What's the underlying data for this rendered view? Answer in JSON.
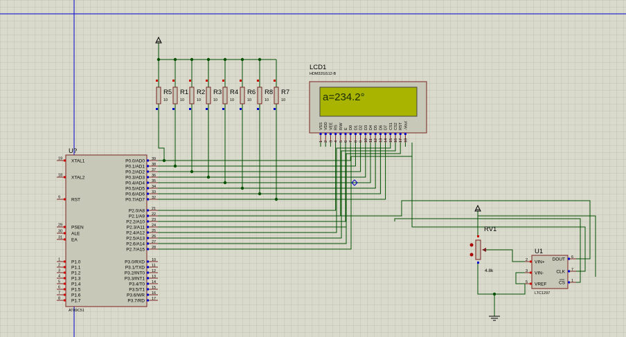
{
  "mcu": {
    "ref": "U?",
    "part": "AT89C51",
    "left_pins": [
      {
        "num": "19",
        "name": "XTAL1"
      },
      {
        "num": "18",
        "name": "XTAL2"
      },
      {
        "num": "9",
        "name": "RST"
      },
      {
        "num": "29",
        "name": "PSEN"
      },
      {
        "num": "30",
        "name": "ALE"
      },
      {
        "num": "31",
        "name": "EA"
      },
      {
        "num": "1",
        "name": "P1.0"
      },
      {
        "num": "2",
        "name": "P1.1"
      },
      {
        "num": "3",
        "name": "P1.2"
      },
      {
        "num": "4",
        "name": "P1.3"
      },
      {
        "num": "5",
        "name": "P1.4"
      },
      {
        "num": "6",
        "name": "P1.5"
      },
      {
        "num": "7",
        "name": "P1.6"
      },
      {
        "num": "8",
        "name": "P1.7"
      }
    ],
    "right_pins": [
      {
        "num": "39",
        "name": "P0.0/AD0"
      },
      {
        "num": "38",
        "name": "P0.1/AD1"
      },
      {
        "num": "37",
        "name": "P0.2/AD2"
      },
      {
        "num": "36",
        "name": "P0.3/AD3"
      },
      {
        "num": "35",
        "name": "P0.4/AD4"
      },
      {
        "num": "34",
        "name": "P0.5/AD5"
      },
      {
        "num": "33",
        "name": "P0.6/AD6"
      },
      {
        "num": "32",
        "name": "P0.7/AD7"
      },
      {
        "num": "21",
        "name": "P2.0/A8"
      },
      {
        "num": "22",
        "name": "P2.1/A9"
      },
      {
        "num": "23",
        "name": "P2.2/A10"
      },
      {
        "num": "24",
        "name": "P2.3/A11"
      },
      {
        "num": "25",
        "name": "P2.4/A12"
      },
      {
        "num": "26",
        "name": "P2.5/A13"
      },
      {
        "num": "27",
        "name": "P2.6/A14"
      },
      {
        "num": "28",
        "name": "P2.7/A15"
      },
      {
        "num": "10",
        "name": "P3.0/RXD"
      },
      {
        "num": "11",
        "name": "P3.1/TXD"
      },
      {
        "num": "12",
        "name": "P3.2/INT0"
      },
      {
        "num": "13",
        "name": "P3.3/INT1"
      },
      {
        "num": "14",
        "name": "P3.4/T0"
      },
      {
        "num": "15",
        "name": "P3.5/T1"
      },
      {
        "num": "16",
        "name": "P3.6/WR"
      },
      {
        "num": "17",
        "name": "P3.7/RD"
      }
    ]
  },
  "resistors": [
    {
      "ref": "R5",
      "value": "10"
    },
    {
      "ref": "R1",
      "value": "10"
    },
    {
      "ref": "R2",
      "value": "10"
    },
    {
      "ref": "R3",
      "value": "10"
    },
    {
      "ref": "R4",
      "value": "10"
    },
    {
      "ref": "R6",
      "value": "10"
    },
    {
      "ref": "R8",
      "value": "10"
    },
    {
      "ref": "R7",
      "value": "10"
    }
  ],
  "lcd": {
    "ref": "LCD1",
    "part": "HDM32GS12-B",
    "display_text": "a=234.2°",
    "pin_names": [
      "VSS",
      "VDD",
      "VEE",
      "RS",
      "R/W",
      "E",
      "D0",
      "D1",
      "D2",
      "D3",
      "D4",
      "D5",
      "D6",
      "D7",
      "CS1",
      "CS2",
      "RST",
      "-Vout"
    ],
    "pin_numbers": [
      "1",
      "2",
      "3",
      "4",
      "5",
      "6",
      "7",
      "8",
      "9",
      "10",
      "11",
      "12",
      "13",
      "14",
      "15",
      "16",
      "17",
      "18"
    ]
  },
  "pot": {
    "ref": "RV1",
    "value": "4.8k"
  },
  "adc": {
    "ref": "U1",
    "part": "LTC1297",
    "left_pins": [
      {
        "num": "2",
        "name": "VIN+"
      },
      {
        "num": "3",
        "name": "VIN-"
      },
      {
        "num": "5",
        "name": "VREF"
      }
    ],
    "right_pins": [
      {
        "num": "6",
        "name": "DOUT"
      },
      {
        "num": "7",
        "name": "CLK"
      },
      {
        "num": "1",
        "name": "CS"
      }
    ]
  },
  "colors": {
    "background": "#d9d9cc",
    "grid": "#c4c4b4",
    "wire": "#005000",
    "component_fill": "#c8c8b8",
    "lcd_screen": "#a8b400",
    "pin_red": "#cc0000",
    "pin_blue": "#0000cc"
  }
}
